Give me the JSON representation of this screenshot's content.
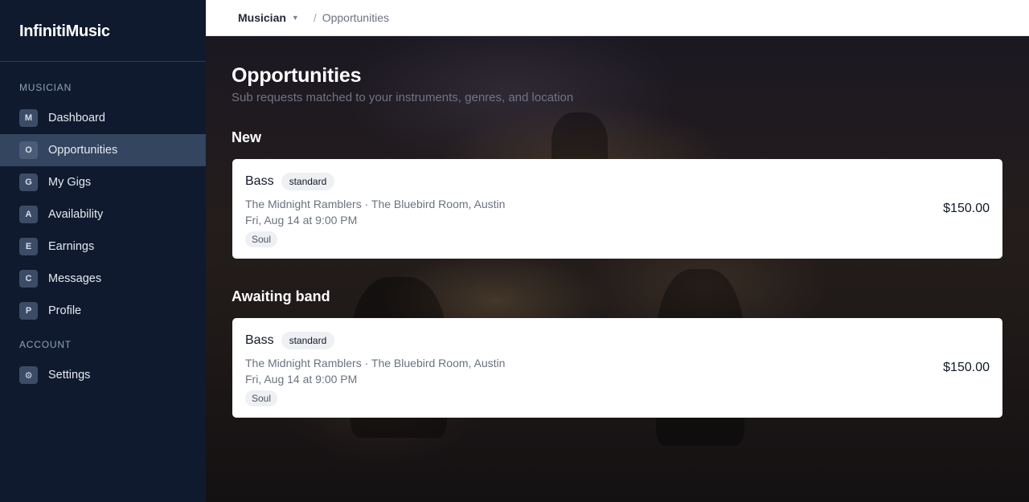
{
  "app": {
    "name": "InfinitiMusic"
  },
  "sidebar": {
    "sections": [
      {
        "label": "MUSICIAN",
        "items": [
          {
            "badge": "M",
            "label": "Dashboard"
          },
          {
            "badge": "O",
            "label": "Opportunities",
            "active": true
          },
          {
            "badge": "G",
            "label": "My Gigs"
          },
          {
            "badge": "A",
            "label": "Availability"
          },
          {
            "badge": "E",
            "label": "Earnings"
          },
          {
            "badge": "C",
            "label": "Messages"
          },
          {
            "badge": "P",
            "label": "Profile"
          }
        ]
      },
      {
        "label": "ACCOUNT",
        "items": [
          {
            "badge": "⚙",
            "icon": "gear-icon",
            "label": "Settings"
          }
        ]
      }
    ]
  },
  "topbar": {
    "role": "Musician",
    "caret_icon": "caret-down-icon",
    "separator": "/",
    "current": "Opportunities"
  },
  "page": {
    "title": "Opportunities",
    "subtitle": "Sub requests matched to your instruments, genres, and location"
  },
  "sections": [
    {
      "heading": "New",
      "card": {
        "instrument": "Bass",
        "tier": "standard",
        "venue": "The Midnight Ramblers · The Bluebird Room, Austin",
        "date": "Fri, Aug 14 at 9:00 PM",
        "genre": "Soul",
        "price": "$150.00"
      }
    },
    {
      "heading": "Awaiting band",
      "card": {
        "instrument": "Bass",
        "tier": "standard",
        "venue": "The Midnight Ramblers · The Bluebird Room, Austin",
        "date": "Fri, Aug 14 at 9:00 PM",
        "genre": "Soul",
        "price": "$150.00"
      }
    }
  ]
}
